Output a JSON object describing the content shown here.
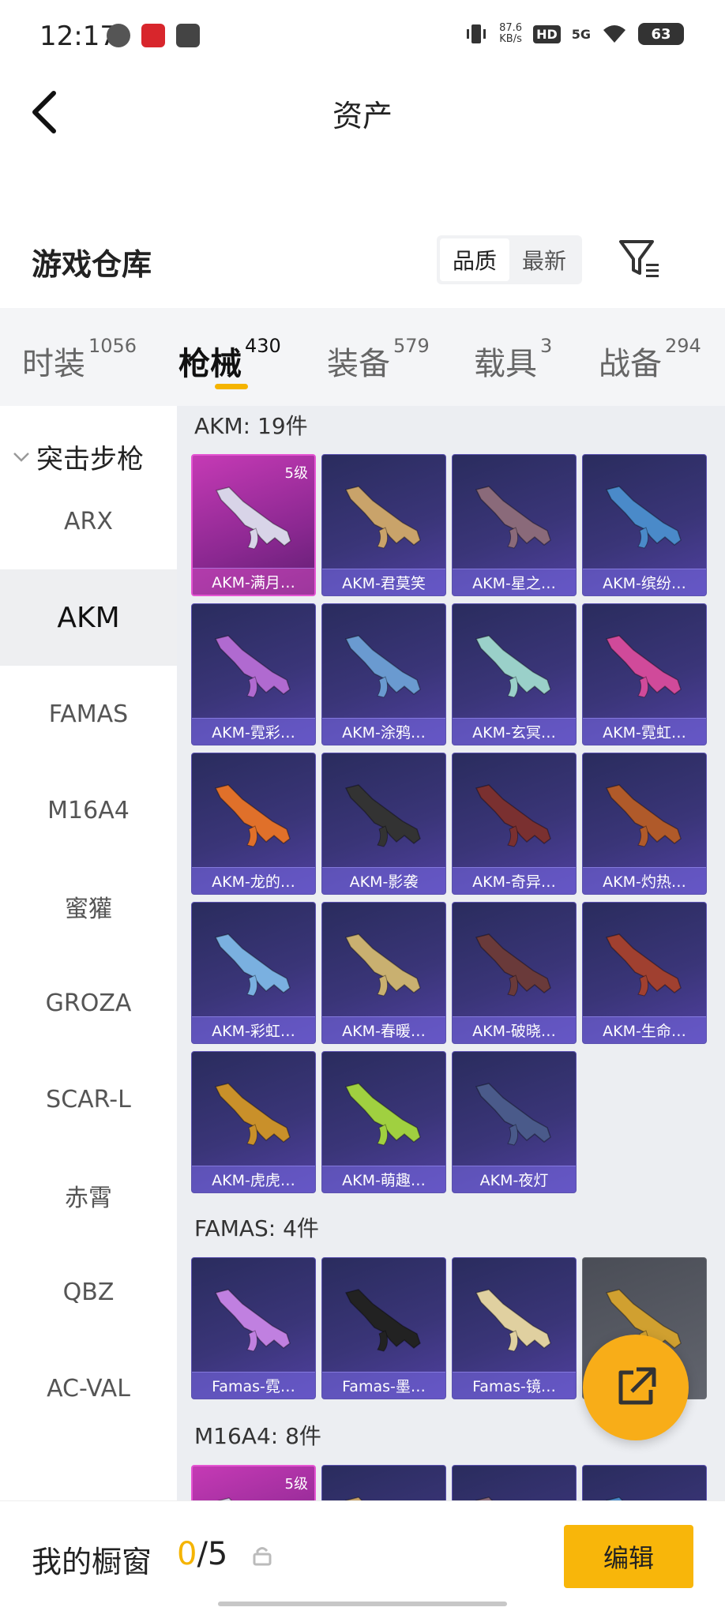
{
  "status": {
    "time": "12:17",
    "speed_value": "87.6",
    "speed_unit": "KB/s",
    "hd": "HD",
    "network": "5G",
    "battery": "63"
  },
  "header": {
    "title": "资产"
  },
  "warehouse": {
    "title": "游戏仓库",
    "sort_options": [
      "品质",
      "最新"
    ],
    "active_sort": "品质"
  },
  "tabs": [
    {
      "label": "时装",
      "count": "1056"
    },
    {
      "label": "枪械",
      "count": "430"
    },
    {
      "label": "装备",
      "count": "579"
    },
    {
      "label": "载具",
      "count": "3"
    },
    {
      "label": "战备",
      "count": "294"
    }
  ],
  "sidebar": {
    "group": "突击步枪",
    "items": [
      "ARX",
      "AKM",
      "FAMAS",
      "M16A4",
      "蜜獾",
      "GROZA",
      "SCAR-L",
      "赤霄",
      "QBZ",
      "AC-VAL"
    ],
    "active": "AKM"
  },
  "sections": [
    {
      "title": "AKM: 19件",
      "items": [
        {
          "label": "AKM-满月…",
          "level": "5级",
          "style": "pink"
        },
        {
          "label": "AKM-君莫笑"
        },
        {
          "label": "AKM-星之…"
        },
        {
          "label": "AKM-缤纷…"
        },
        {
          "label": "AKM-霓彩…"
        },
        {
          "label": "AKM-涂鸦…"
        },
        {
          "label": "AKM-玄冥…"
        },
        {
          "label": "AKM-霓虹…"
        },
        {
          "label": "AKM-龙的…"
        },
        {
          "label": "AKM-影袭"
        },
        {
          "label": "AKM-奇异…"
        },
        {
          "label": "AKM-灼热…"
        },
        {
          "label": "AKM-彩虹…"
        },
        {
          "label": "AKM-春暖…"
        },
        {
          "label": "AKM-破晓…"
        },
        {
          "label": "AKM-生命…"
        },
        {
          "label": "AKM-虎虎…"
        },
        {
          "label": "AKM-萌趣…"
        },
        {
          "label": "AKM-夜灯"
        }
      ]
    },
    {
      "title": "FAMAS: 4件",
      "items": [
        {
          "label": "Famas-霓…"
        },
        {
          "label": "Famas-墨…"
        },
        {
          "label": "Famas-镜…"
        },
        {
          "label": "",
          "style": "grey"
        }
      ]
    },
    {
      "title": "M16A4: 8件",
      "items": [
        {
          "label": "",
          "level": "5级",
          "style": "pink"
        },
        {
          "label": ""
        },
        {
          "label": ""
        },
        {
          "label": ""
        }
      ]
    }
  ],
  "showcase": {
    "title": "我的橱窗",
    "current": "0",
    "total": "/5",
    "edit_label": "编辑"
  },
  "colors": {
    "accent": "#f5b400",
    "card_bg": "#3a3578",
    "card_pink": "#c53ab5"
  },
  "icons": [
    "back-arrow-icon",
    "filter-icon",
    "chevron-down-icon",
    "share-icon",
    "lock-icon"
  ]
}
